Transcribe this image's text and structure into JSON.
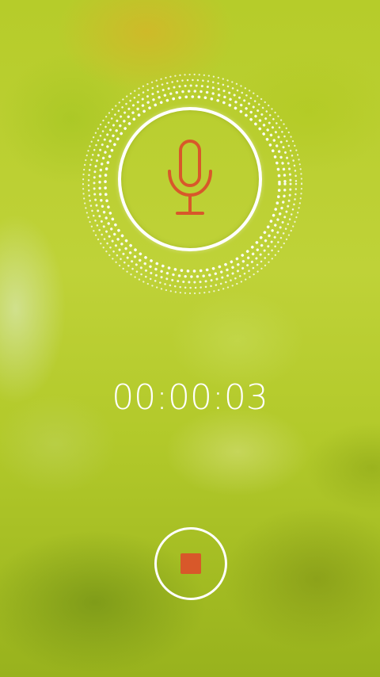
{
  "recorder": {
    "elapsed_time": "00:00:03",
    "state": "recording"
  },
  "icons": {
    "mic": "microphone-icon",
    "stop": "stop-icon",
    "level_rings": "dotted-level-rings"
  },
  "colors": {
    "accent": "#d8582a",
    "ring": "#ffffff",
    "timer_text": "#ffffff"
  }
}
